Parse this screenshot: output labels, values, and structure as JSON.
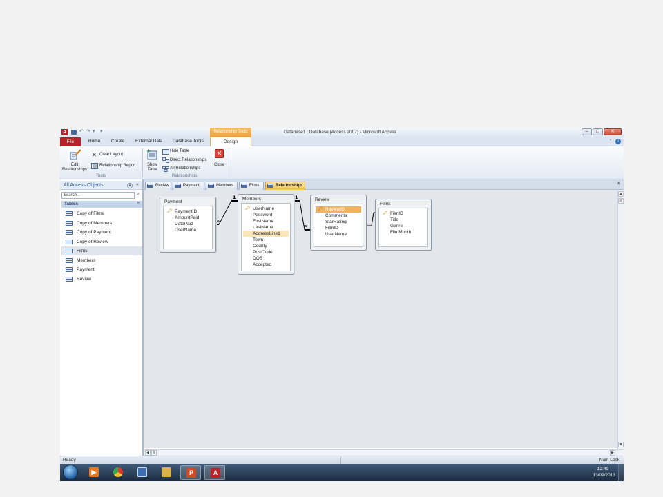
{
  "window": {
    "title": "Database1 : Database (Access 2007)  -  Microsoft Access",
    "app_icon_letter": "A",
    "context_tab_header": "Relationship Tools",
    "minimize": "–",
    "maximize": "□",
    "close": "✕"
  },
  "ribbon_tabs": [
    "File",
    "Home",
    "Create",
    "External Data",
    "Database Tools",
    "Design"
  ],
  "ribbon": {
    "edit_relationships": [
      "Edit",
      "Relationships"
    ],
    "clear_layout": "Clear Layout",
    "relationship_report": "Relationship Report",
    "group_tools": "Tools",
    "show_table": [
      "Show",
      "Table"
    ],
    "hide_table": "Hide Table",
    "direct_relationships": "Direct Relationships",
    "all_relationships": "All Relationships",
    "close": "Close",
    "group_relationships": "Relationships"
  },
  "nav": {
    "title": "All Access Objects",
    "search_placeholder": "Search...",
    "group_label": "Tables",
    "group_toggle": "»",
    "items": [
      "Copy of Films",
      "Copy of Members",
      "Copy of Payment",
      "Copy of Review",
      "Films",
      "Members",
      "Payment",
      "Review"
    ],
    "selected": "Films"
  },
  "doc_tabs": [
    "Review",
    "Payment",
    "Members",
    "Films",
    "Relationships"
  ],
  "doc_active_tab": "Relationships",
  "tables": {
    "payment": {
      "title": "Payment",
      "fields": [
        "PaymentID",
        "AmountPaid",
        "DatePaid",
        "UserName"
      ],
      "key": "PaymentID"
    },
    "members": {
      "title": "Members",
      "fields": [
        "UserName",
        "Password",
        "FirstName",
        "LastName",
        "AddressLine1",
        "Town",
        "County",
        "PostCode",
        "DOB",
        "Accepted"
      ],
      "key": "UserName",
      "highlighted": "AddressLine1"
    },
    "review": {
      "title": "Review",
      "fields": [
        "ReviewID",
        "Comments",
        "StarRating",
        "FilmID",
        "UserName"
      ],
      "key": "ReviewID",
      "selected": "ReviewID"
    },
    "films": {
      "title": "Films",
      "fields": [
        "FilmID",
        "Title",
        "Genre",
        "FilmMonth"
      ],
      "key": "FilmID"
    }
  },
  "relationship_symbols": {
    "one": "1",
    "many": "∞"
  },
  "status": {
    "left": "Ready",
    "right": "Num Lock"
  },
  "taskbar": {
    "clock_time": "12:49",
    "clock_date": "13/09/2013",
    "apps": [
      "windows-media-player",
      "chrome",
      "remote-desktop",
      "file-explorer",
      "powerpoint",
      "access"
    ]
  },
  "colors": {
    "file_tab": "#b8222a",
    "context_tab": "#e8a13d",
    "active_doc_tab": "#f2c451",
    "field_highlight": "#fbe6b8",
    "field_selected": "#f2b35c"
  }
}
